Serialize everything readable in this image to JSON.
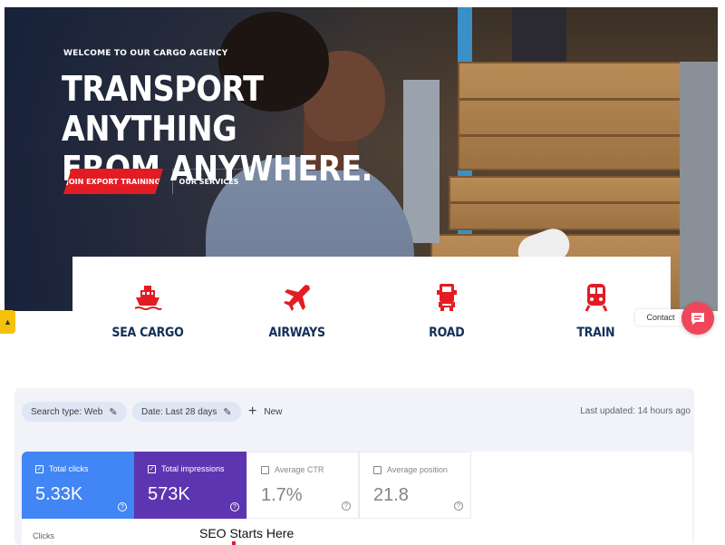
{
  "hero": {
    "eyebrow": "WELCOME TO OUR CARGO AGENCY",
    "headline_line1": "TRANSPORT ANYTHING",
    "headline_line2": "FROM ANYWHERE.",
    "primary_button": "JOIN EXPORT TRAINING",
    "secondary_button": "OUR SERVICES",
    "accent_color": "#e31c23"
  },
  "services": [
    {
      "label": "SEA CARGO",
      "icon": "ship-icon"
    },
    {
      "label": "AIRWAYS",
      "icon": "airplane-icon"
    },
    {
      "label": "ROAD",
      "icon": "truck-icon"
    },
    {
      "label": "TRAIN",
      "icon": "train-icon"
    }
  ],
  "contact": {
    "label": "Contact",
    "icon": "chat-icon",
    "color": "#f0465a"
  },
  "search_console": {
    "filters": [
      {
        "label": "Search type: Web"
      },
      {
        "label": "Date: Last 28 days"
      }
    ],
    "new_label": "New",
    "last_updated": "Last updated: 14 hours ago",
    "metrics": [
      {
        "label": "Total clicks",
        "value": "5.33K",
        "checked": true,
        "color": "#4285f4"
      },
      {
        "label": "Total impressions",
        "value": "573K",
        "checked": true,
        "color": "#5e35b1"
      },
      {
        "label": "Average CTR",
        "value": "1.7%",
        "checked": false
      },
      {
        "label": "Average position",
        "value": "21.8",
        "checked": false
      }
    ],
    "chart_label": "Clicks"
  },
  "caption": "SEO Starts Here"
}
